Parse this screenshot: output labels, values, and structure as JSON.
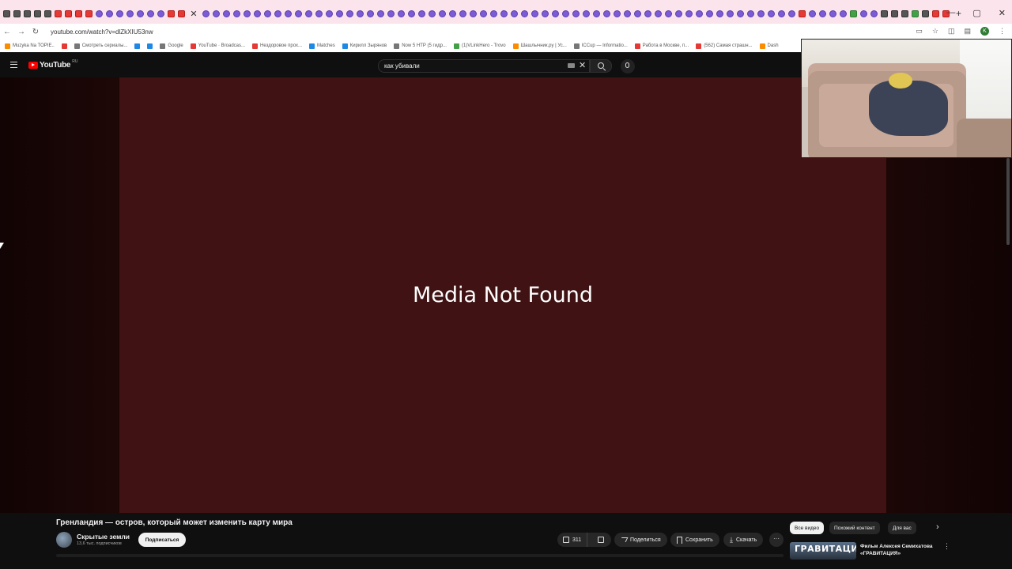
{
  "browser": {
    "url": "youtube.com/watch?v=dlZkXIU53nw",
    "new_tab": "+",
    "win_min": "—",
    "win_max": "▢",
    "win_close": "✕",
    "bookmarks": [
      {
        "label": "Muzyka Na TOPIE..",
        "color": "orange"
      },
      {
        "label": "",
        "color": "red"
      },
      {
        "label": "Смотреть сериалы...",
        "color": "grey"
      },
      {
        "label": "",
        "color": "blue"
      },
      {
        "label": "",
        "color": "blue"
      },
      {
        "label": "Google",
        "color": "grey"
      },
      {
        "label": "YouTube · Broadcas...",
        "color": "red"
      },
      {
        "label": "Нездоровое прох...",
        "color": "red"
      },
      {
        "label": "Matches",
        "color": "blue"
      },
      {
        "label": "Кирилл Зырянов",
        "color": "blue"
      },
      {
        "label": "Now 5 НТР (5 гидр...",
        "color": "grey"
      },
      {
        "label": "(1)VLinkHero - Trovo",
        "color": "green"
      },
      {
        "label": "Шашлычник.ру | Ус...",
        "color": "orange"
      },
      {
        "label": "ICCup — Informatio...",
        "color": "grey"
      },
      {
        "label": "Работа в Москве, п...",
        "color": "red"
      },
      {
        "label": "(562) Самая страшн...",
        "color": "red"
      },
      {
        "label": "Dash",
        "color": "orange"
      }
    ]
  },
  "youtube": {
    "logo_text": "YouTube",
    "logo_region": "RU",
    "search": {
      "value": "как убивали",
      "clear": "✕"
    },
    "player": {
      "message": "Media Not Found"
    },
    "video": {
      "title": "Гренландия — остров, который может изменить карту мира",
      "channel": "Скрытые земли",
      "subscribers": "13,6 тыс. подписчиков",
      "subscribe_label": "Подписаться",
      "likes": "311",
      "share_label": "Поделиться",
      "save_label": "Сохранить",
      "download_label": "Скачать",
      "more": "···"
    },
    "chips": [
      "Все видео",
      "Похожий контент",
      "Для вас"
    ],
    "chip_next": "›",
    "recommendation": {
      "thumb_text": "ГРАВИТАЦИЯ",
      "title": "Фильм Алексея Семихатова «ГРАВИТАЦИЯ»",
      "menu": "⋮"
    }
  }
}
